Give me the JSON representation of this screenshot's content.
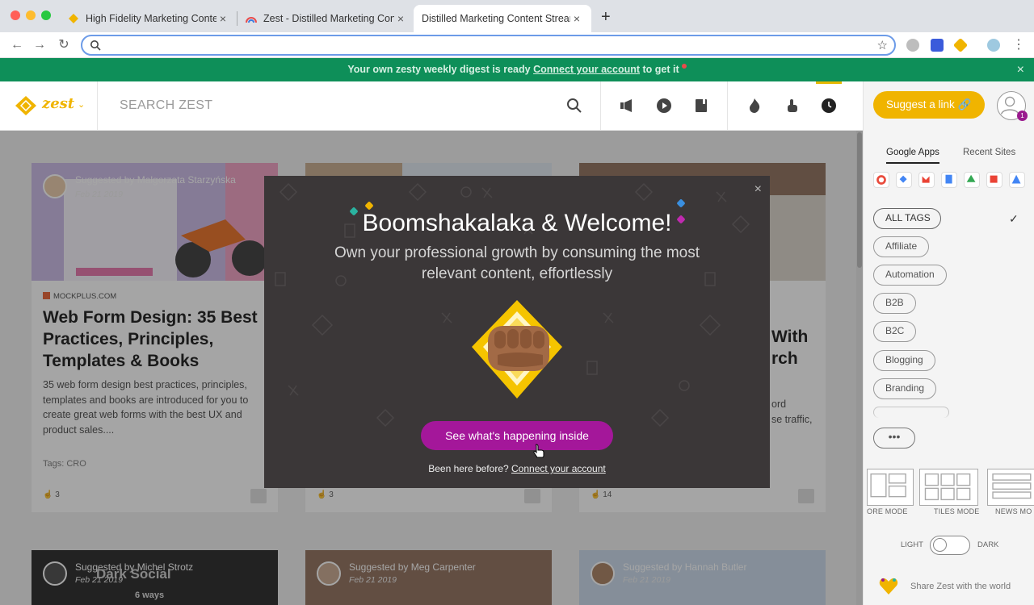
{
  "browser": {
    "tabs": [
      {
        "label": "High Fidelity Marketing Content",
        "active": false
      },
      {
        "label": "Zest - Distilled Marketing Content",
        "active": false
      },
      {
        "label": "Distilled Marketing Content Stream",
        "active": true
      }
    ],
    "new_tab": "+",
    "close_glyph": "×",
    "address_value": "",
    "address_placeholder": ""
  },
  "banner": {
    "text_before": "Your own zesty weekly digest is ready ",
    "link": "Connect your account",
    "text_after": " to get it",
    "close": "×"
  },
  "header": {
    "logo_text": "zest",
    "search_placeholder": "SEARCH ZEST",
    "icons": [
      "search-icon",
      "megaphone-icon",
      "play-icon",
      "book-icon",
      "flame-icon",
      "pointer-icon",
      "clock-icon"
    ],
    "accent": "#f0b400"
  },
  "sidebar": {
    "suggest_label": "Suggest a link",
    "avatar_badge": "1",
    "tabs": [
      "Google Apps",
      "Recent Sites"
    ],
    "tags": [
      "ALL TAGS",
      "Affiliate",
      "Automation",
      "B2B",
      "B2C",
      "Blogging",
      "Branding"
    ],
    "more": "•••",
    "modes": [
      "ORE MODE",
      "TILES MODE",
      "NEWS MO"
    ],
    "theme_light": "LIGHT",
    "theme_dark": "DARK",
    "share": "Share Zest with the world"
  },
  "feed": {
    "cards": [
      {
        "suggested_by": "Suggested by Malgorzata Starzyńska",
        "date": "Feb 21 2019",
        "source": "MOCKPLUS.COM",
        "title": "Web Form Design: 35 Best Practices, Principles, Templates & Books",
        "description": "35 web form design best practices, principles, templates and books are introduced for you to create great web forms with the best UX and product sales....",
        "tags": "Tags: CRO",
        "likes": "3"
      },
      {
        "likes": "3"
      },
      {
        "title_fragment_1": "With",
        "title_fragment_2": "rch",
        "desc_fragment_1": "ord",
        "desc_fragment_2": "se traffic,",
        "likes": "14"
      }
    ],
    "row2": [
      {
        "suggested_by": "Suggested by Michel Strotz",
        "date": "Feb 21 2019",
        "overlay_text": "Dark Social",
        "overlay_sub": "6 ways"
      },
      {
        "suggested_by": "Suggested by Meg Carpenter",
        "date": "Feb 21 2019"
      },
      {
        "suggested_by": "Suggested by Hannah Butler",
        "date": "Feb 21 2019"
      }
    ]
  },
  "modal": {
    "close": "×",
    "title": "Boomshakalaka & Welcome!",
    "subtitle": "Own your professional growth by consuming the most relevant content, effortlessly",
    "cta": "See what's happening inside",
    "footer_text": "Been here before? ",
    "footer_link": "Connect your account",
    "cta_color": "#a4179a"
  }
}
